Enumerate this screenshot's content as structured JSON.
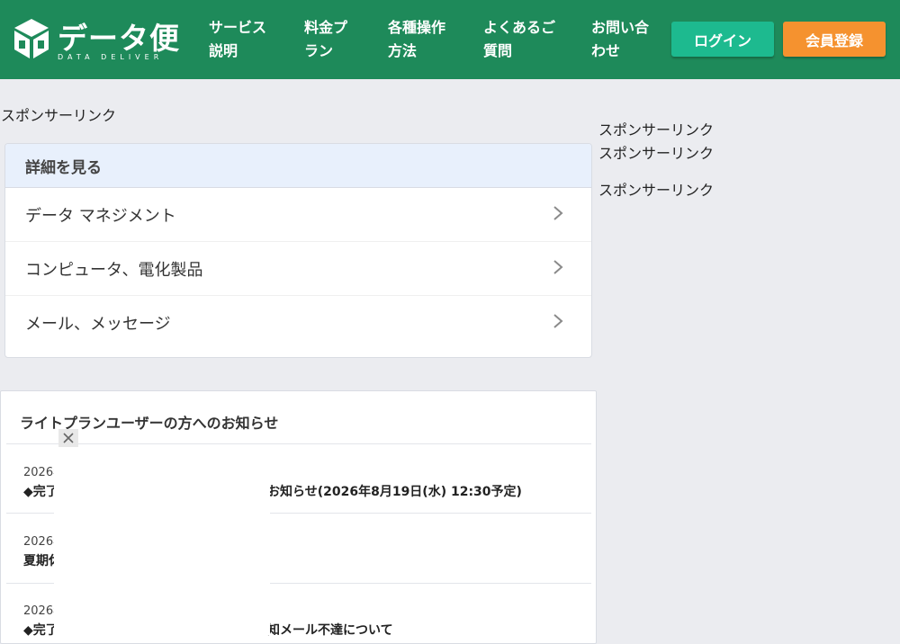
{
  "header": {
    "logo": {
      "text": "データ便",
      "subtext": "DATA DELIVER"
    },
    "nav": [
      {
        "line1": "サービス",
        "line2": "説明"
      },
      {
        "line1": "料金プ",
        "line2": "ラン"
      },
      {
        "line1": "各種操作",
        "line2": "方法"
      },
      {
        "line1": "よくあるご",
        "line2": "質問"
      },
      {
        "line1": "お問い合",
        "line2": "わせ"
      }
    ],
    "login_label": "ログイン",
    "register_label": "会員登録"
  },
  "sponsor_label": "スポンサーリンク",
  "detail": {
    "heading": "詳細を見る",
    "items": [
      "データ マネジメント",
      "コンピュータ、電化製品",
      "メール、メッセージ"
    ]
  },
  "news": {
    "title": "ライトプランユーザーの方へのお知らせ",
    "items": [
      {
        "date": "2026年",
        "text_left": "◆完了",
        "text_right": "お知らせ(2026年8月19日(水) 12:30予定)"
      },
      {
        "date": "2026年",
        "text_left": "夏期休",
        "text_right": ""
      },
      {
        "date": "2026年",
        "text_left": "◆完了",
        "text_right": "知メール不達について"
      }
    ]
  },
  "colors": {
    "header_bg": "#1e8a5a",
    "login_bg": "#1dba8f",
    "register_bg": "#f5922f",
    "page_bg": "#ebecf0"
  },
  "icons": {
    "logo": "cube-logo-icon",
    "chevron": "chevron-right-icon",
    "close": "close-icon"
  }
}
